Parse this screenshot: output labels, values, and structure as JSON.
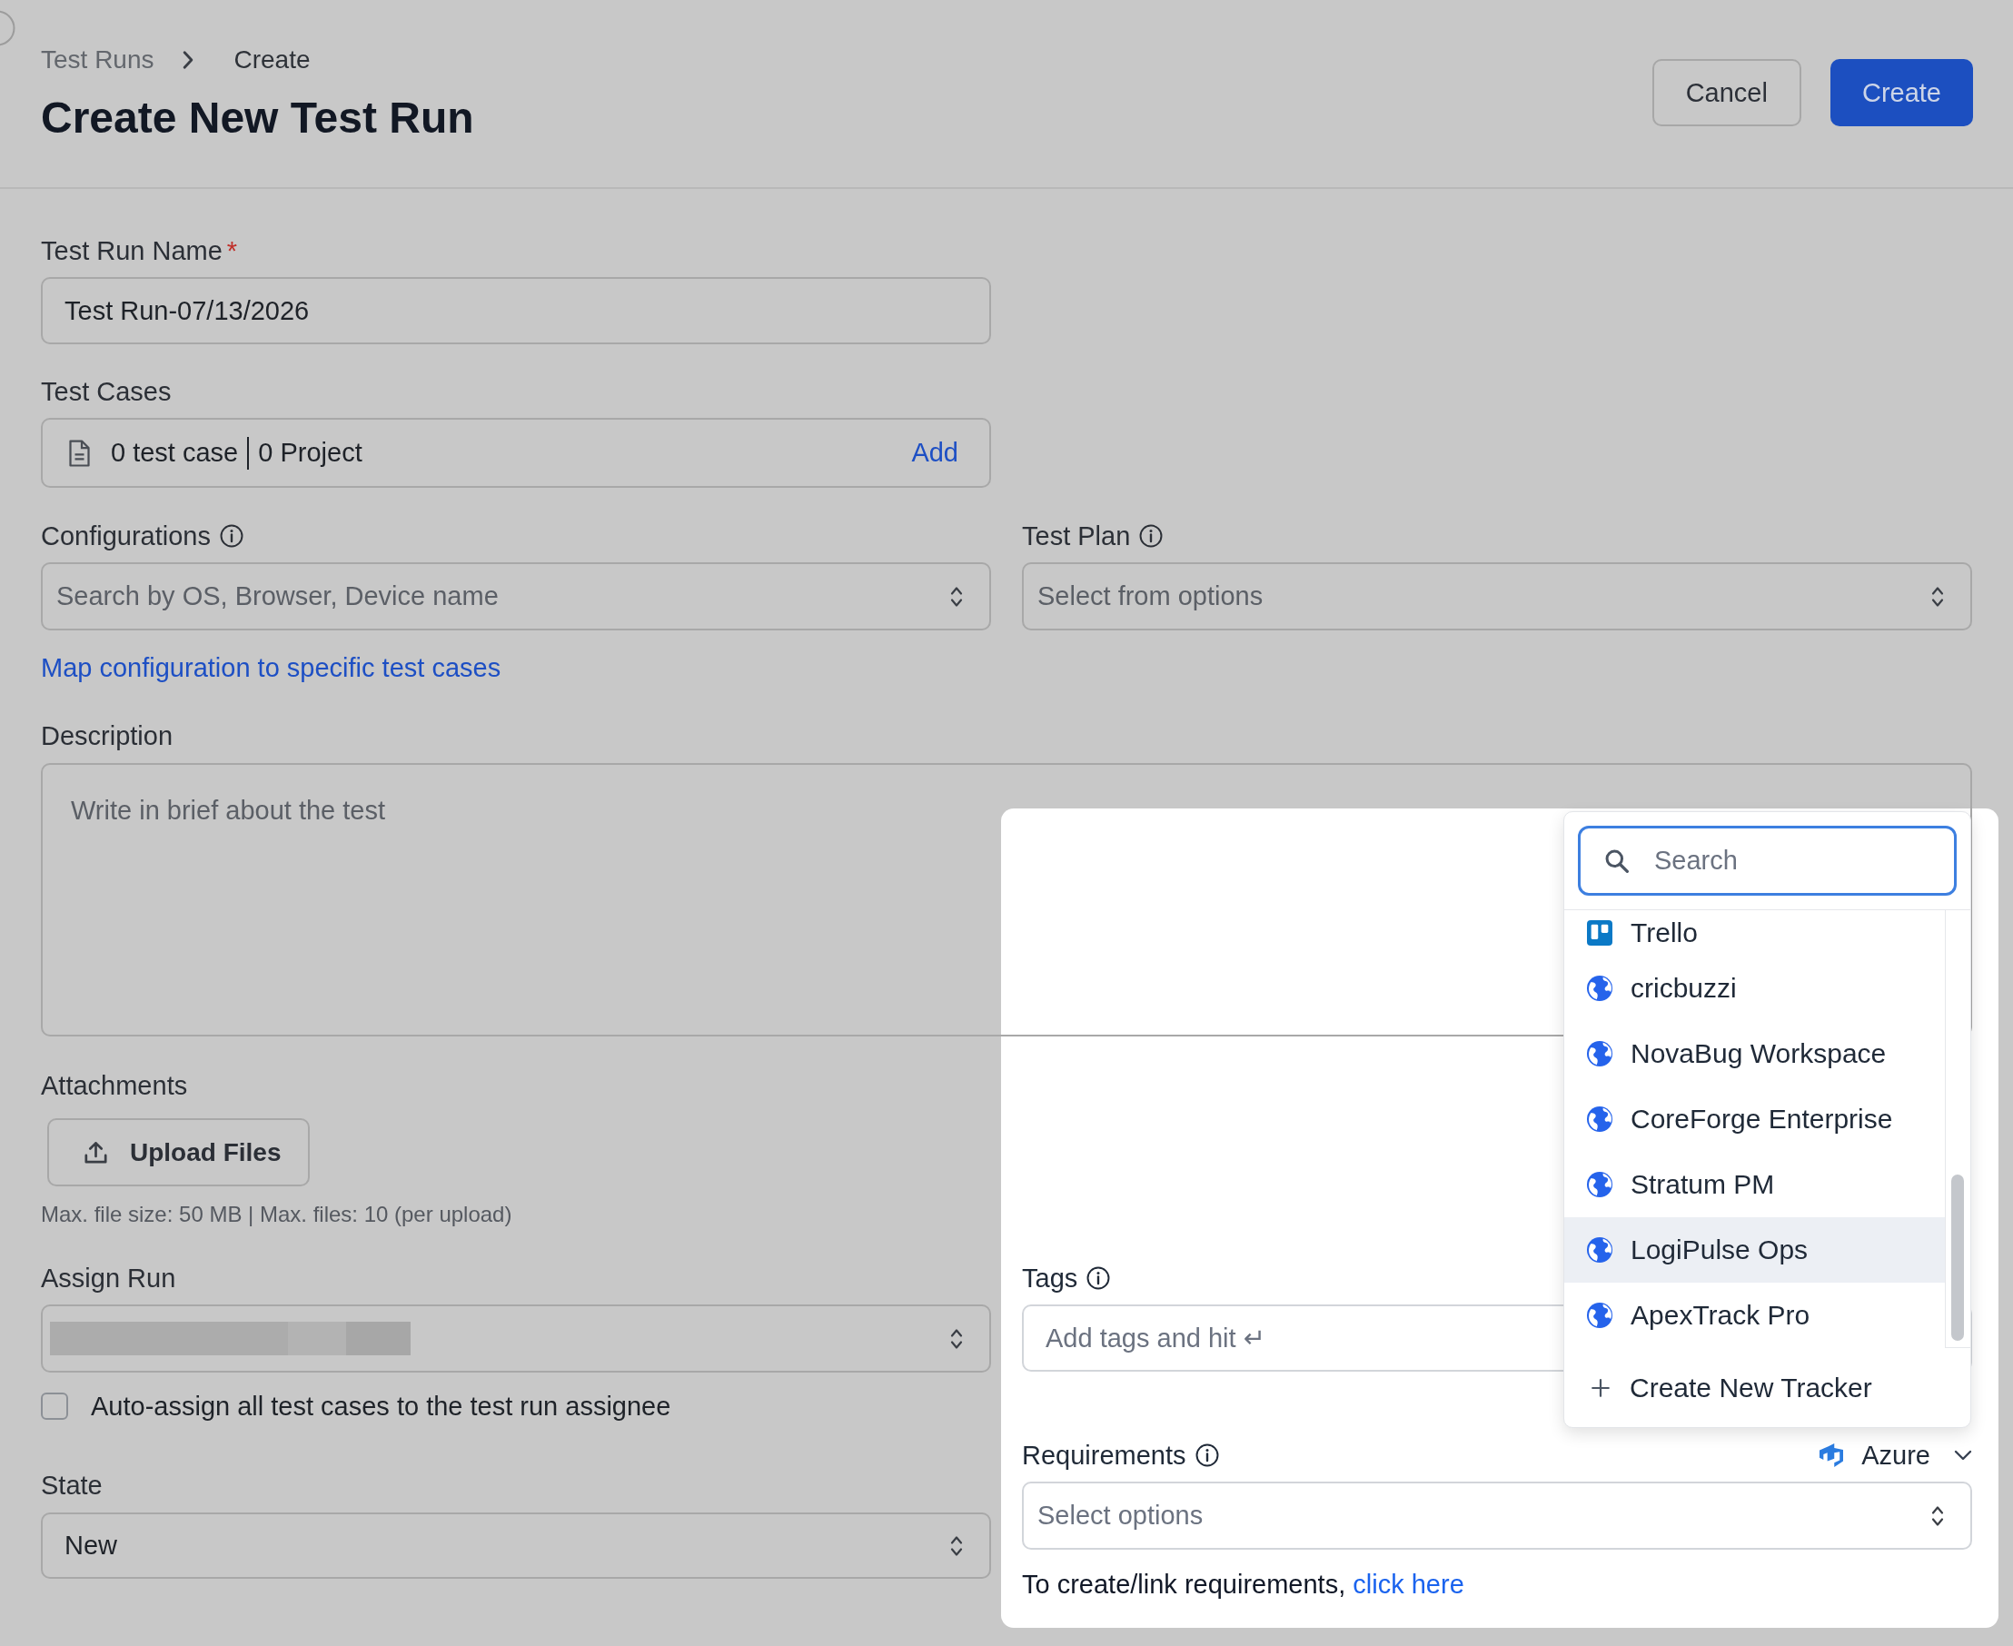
{
  "breadcrumb": [
    {
      "label": "Test Runs",
      "current": false
    },
    {
      "label": "Create",
      "current": true
    }
  ],
  "page_title": "Create New Test Run",
  "actions": [
    {
      "label": "Cancel",
      "kind": "secondary"
    },
    {
      "label": "Create",
      "kind": "primary"
    }
  ],
  "form": {
    "test_run_name": {
      "label": "Test Run Name",
      "required_mark": "*",
      "value": "Test Run-07/13/2026"
    },
    "test_cases": {
      "label": "Test Cases",
      "summary": [
        "0 test case",
        "0 Project"
      ],
      "action": "Add"
    },
    "configurations": {
      "label": "Configurations",
      "info": true,
      "placeholder": "Search by OS, Browser, Device name"
    },
    "test_plan": {
      "label": "Test Plan",
      "info": true,
      "placeholder": "Select from options"
    },
    "map_link": "Map configuration to specific test cases",
    "description": {
      "label": "Description",
      "placeholder": "Write in brief about the test"
    },
    "attachments": {
      "label": "Attachments",
      "button": "Upload Files",
      "hint": "Max. file size: 50 MB | Max. files: 10 (per upload)"
    },
    "assign_run": {
      "label": "Assign Run",
      "value_redacted": true
    },
    "auto_assign": {
      "label": "Auto-assign all test cases to the test run assignee",
      "checked": false
    },
    "state": {
      "label": "State",
      "value": "New"
    },
    "tags": {
      "label": "Tags",
      "info": true,
      "placeholder": "Add tags and hit ↵"
    },
    "requirements": {
      "label": "Requirements",
      "info": true,
      "tracker": "Azure",
      "placeholder": "Select options",
      "note": "To create/link requirements,",
      "note_link": "click here"
    }
  },
  "tracker_menu": {
    "search_placeholder": "Search",
    "items": [
      {
        "label": "Trello",
        "kind": "trello",
        "hovered": false
      },
      {
        "label": "cricbuzzi",
        "kind": "web",
        "hovered": false
      },
      {
        "label": "NovaBug Workspace",
        "kind": "web",
        "hovered": false
      },
      {
        "label": "CoreForge Enterprise",
        "kind": "web",
        "hovered": false
      },
      {
        "label": "Stratum PM",
        "kind": "web",
        "hovered": false
      },
      {
        "label": "LogiPulse Ops",
        "kind": "web",
        "hovered": true
      },
      {
        "label": "ApexTrack Pro",
        "kind": "web",
        "hovered": false
      }
    ],
    "footer_action": "Create New Tracker"
  }
}
